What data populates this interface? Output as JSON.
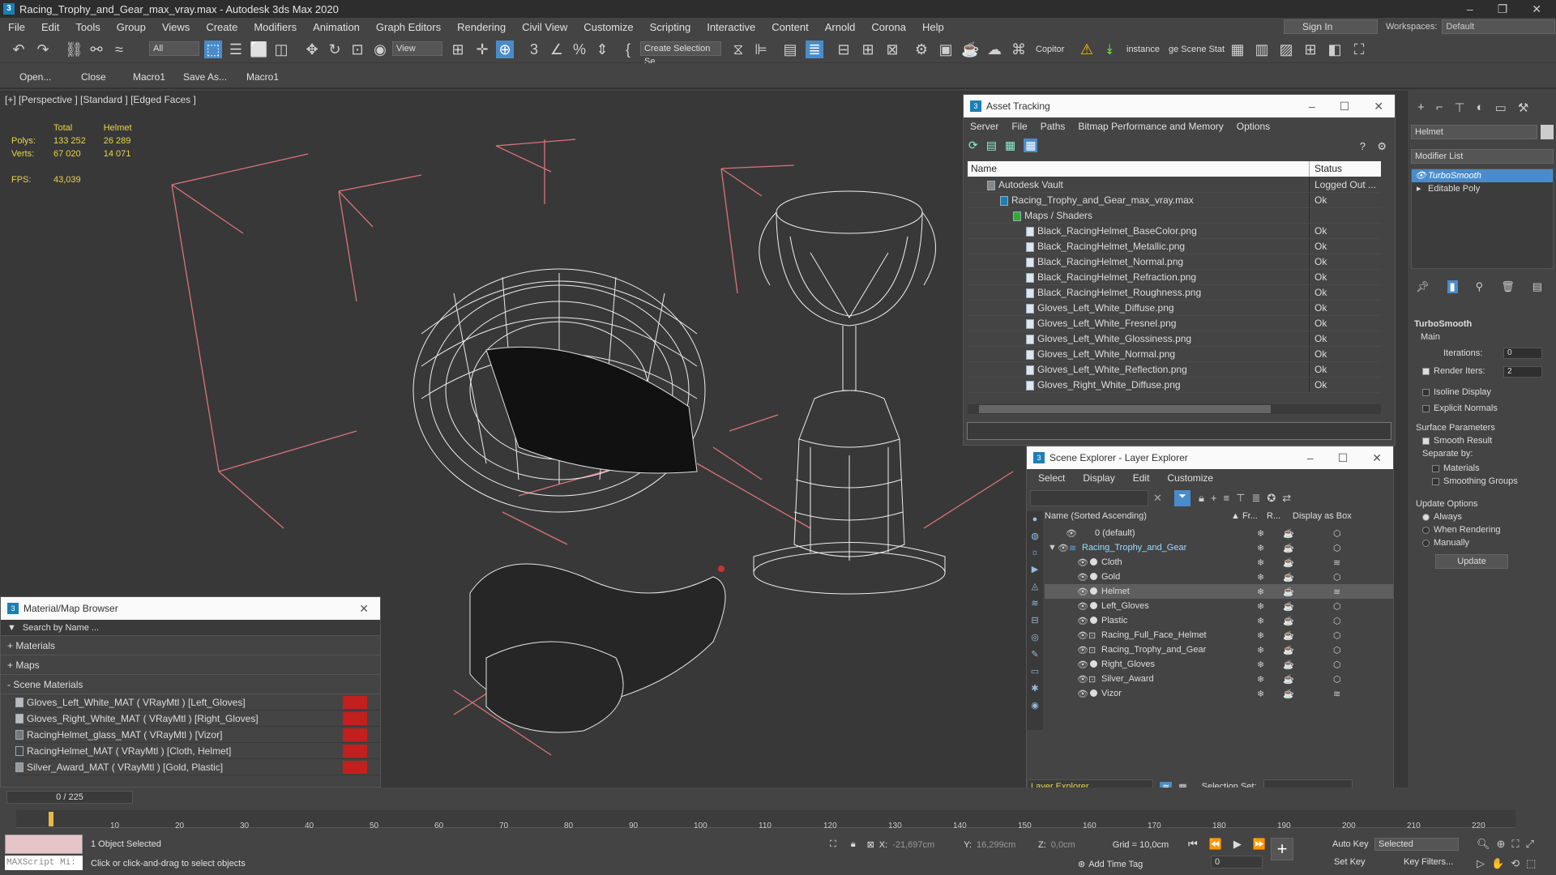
{
  "window": {
    "title": "Racing_Trophy_and_Gear_max_vray.max - Autodesk 3ds Max 2020"
  },
  "menu": [
    "File",
    "Edit",
    "Tools",
    "Group",
    "Views",
    "Create",
    "Modifiers",
    "Animation",
    "Graph Editors",
    "Rendering",
    "Civil View",
    "Customize",
    "Scripting",
    "Interactive",
    "Content",
    "Arnold",
    "Corona",
    "Help"
  ],
  "account": {
    "signin": "Sign In",
    "workspaces_label": "Workspaces:",
    "workspace": "Default"
  },
  "toolbar": {
    "filter": "All",
    "view": "View",
    "selection_set": "Create Selection Se",
    "copitor": "Copitor",
    "instance": "instance",
    "scene_stat": "ge Scene Stat"
  },
  "macros": [
    "Open...",
    "Close",
    "Macro1",
    "Save As...",
    "Macro1"
  ],
  "viewport": {
    "label": "[+] [Perspective ] [Standard ] [Edged Faces ]",
    "stats": {
      "col_total": "Total",
      "col_helmet": "Helmet",
      "polys_label": "Polys:",
      "polys_total": "133 252",
      "polys_helmet": "26 289",
      "verts_label": "Verts:",
      "verts_total": "67 020",
      "verts_helmet": "14 071",
      "fps_label": "FPS:",
      "fps": "43,039"
    }
  },
  "asset_tracking": {
    "title": "Asset Tracking",
    "menu": [
      "Server",
      "File",
      "Paths",
      "Bitmap Performance and Memory",
      "Options"
    ],
    "col_name": "Name",
    "col_status": "Status",
    "rows": [
      {
        "name": "Autodesk Vault",
        "status": "Logged Out ..."
      },
      {
        "name": "Racing_Trophy_and_Gear_max_vray.max",
        "status": "Ok"
      },
      {
        "name": "Maps / Shaders",
        "status": ""
      },
      {
        "name": "Black_RacingHelmet_BaseColor.png",
        "status": "Ok"
      },
      {
        "name": "Black_RacingHelmet_Metallic.png",
        "status": "Ok"
      },
      {
        "name": "Black_RacingHelmet_Normal.png",
        "status": "Ok"
      },
      {
        "name": "Black_RacingHelmet_Refraction.png",
        "status": "Ok"
      },
      {
        "name": "Black_RacingHelmet_Roughness.png",
        "status": "Ok"
      },
      {
        "name": "Gloves_Left_White_Diffuse.png",
        "status": "Ok"
      },
      {
        "name": "Gloves_Left_White_Fresnel.png",
        "status": "Ok"
      },
      {
        "name": "Gloves_Left_White_Glossiness.png",
        "status": "Ok"
      },
      {
        "name": "Gloves_Left_White_Normal.png",
        "status": "Ok"
      },
      {
        "name": "Gloves_Left_White_Reflection.png",
        "status": "Ok"
      },
      {
        "name": "Gloves_Right_White_Diffuse.png",
        "status": "Ok"
      }
    ]
  },
  "scene_explorer": {
    "title": "Scene Explorer - Layer Explorer",
    "menu": [
      "Select",
      "Display",
      "Edit",
      "Customize"
    ],
    "col_name": "Name (Sorted Ascending)",
    "col_fr": "▲ Fr...",
    "col_r": "R...",
    "col_box": "Display as Box",
    "rows": [
      {
        "name": "0 (default)"
      },
      {
        "name": "Racing_Trophy_and_Gear"
      },
      {
        "name": "Cloth"
      },
      {
        "name": "Gold"
      },
      {
        "name": "Helmet"
      },
      {
        "name": "Left_Gloves"
      },
      {
        "name": "Plastic"
      },
      {
        "name": "Racing_Full_Face_Helmet"
      },
      {
        "name": "Racing_Trophy_and_Gear"
      },
      {
        "name": "Right_Gloves"
      },
      {
        "name": "Silver_Award"
      },
      {
        "name": "Vizor"
      }
    ],
    "footer_dropdown": "Layer Explorer",
    "selection_set_label": "Selection Set:"
  },
  "material_browser": {
    "title": "Material/Map Browser",
    "search": "Search by Name ...",
    "sections": [
      "+ Materials",
      "+ Maps",
      "- Scene Materials"
    ],
    "materials": [
      "Gloves_Left_White_MAT ( VRayMtl ) [Left_Gloves]",
      "Gloves_Right_White_MAT ( VRayMtl ) [Right_Gloves]",
      "RacingHelmet_glass_MAT ( VRayMtl ) [Vizor]",
      "RacingHelmet_MAT ( VRayMtl ) [Cloth, Helmet]",
      "Silver_Award_MAT ( VRayMtl ) [Gold, Plastic]"
    ]
  },
  "command_panel": {
    "object_name": "Helmet",
    "modifier_list": "Modifier List",
    "stack": [
      "TurboSmooth",
      "Editable Poly"
    ],
    "rollout": "TurboSmooth",
    "main": "Main",
    "iterations_label": "Iterations:",
    "iterations": "0",
    "render_iters_label": "Render Iters:",
    "render_iters": "2",
    "isoline": "Isoline Display",
    "explicit": "Explicit Normals",
    "surface": "Surface Parameters",
    "smooth": "Smooth Result",
    "separate": "Separate by:",
    "materials": "Materials",
    "smoothing": "Smoothing Groups",
    "update_opts": "Update Options",
    "always": "Always",
    "when_rendering": "When Rendering",
    "manually": "Manually",
    "update": "Update"
  },
  "timeline": {
    "frame": "0 / 225",
    "ticks": [
      "10",
      "20",
      "30",
      "40",
      "50",
      "60",
      "70",
      "80",
      "90",
      "100",
      "110",
      "120",
      "130",
      "140",
      "150",
      "160",
      "170",
      "180",
      "190",
      "200",
      "210",
      "220"
    ]
  },
  "status": {
    "selected": "1 Object Selected",
    "hint": "Click or click-and-drag to select objects",
    "maxscript": "MAXScript Mi:",
    "x_label": "X:",
    "x": "-21,697cm",
    "y_label": "Y:",
    "y": "16,299cm",
    "z_label": "Z:",
    "z": "0,0cm",
    "grid": "Grid = 10,0cm",
    "add_time_tag": "Add Time Tag",
    "auto_key": "Auto Key",
    "selected_mode": "Selected",
    "set_key": "Set Key",
    "key_filters": "Key Filters...",
    "frame_field": "0"
  },
  "colors": {
    "accent": "#4a8cc9",
    "wire_box": "#d9747c",
    "stats_yellow": "#e8d54a"
  }
}
